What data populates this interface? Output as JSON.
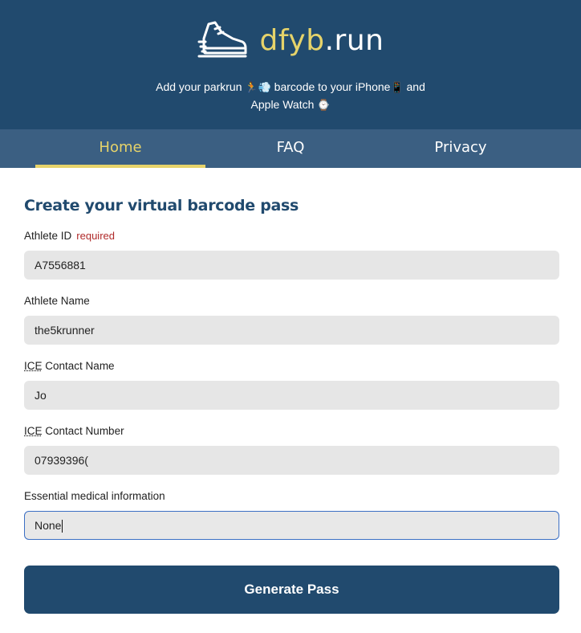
{
  "brand": {
    "accent": "dfyb",
    "rest": ".run"
  },
  "tagline": {
    "line1_a": "Add your parkrun",
    "line1_emoji": "🏃💨",
    "line1_b": "barcode to your iPhone",
    "line1_emoji2": "📱",
    "line1_c": "and",
    "line2": "Apple Watch",
    "line2_emoji": "⌚"
  },
  "nav": {
    "home": "Home",
    "faq": "FAQ",
    "privacy": "Privacy"
  },
  "form": {
    "title": "Create your virtual barcode pass",
    "athlete_id": {
      "label": "Athlete ID",
      "required": "required",
      "value": "A7556881"
    },
    "athlete_name": {
      "label": "Athlete Name",
      "value": "the5krunner"
    },
    "ice_name": {
      "label_abbr": "ICE",
      "label_rest": "Contact Name",
      "value": "Jo"
    },
    "ice_number": {
      "label_abbr": "ICE",
      "label_rest": "Contact Number",
      "value": "07939396("
    },
    "medical": {
      "label": "Essential medical information",
      "value": "None"
    },
    "submit": "Generate Pass"
  },
  "colors": {
    "header": "#214a6e",
    "nav": "#3b5f82",
    "accent": "#e6d36a",
    "required": "#b02a2a"
  }
}
